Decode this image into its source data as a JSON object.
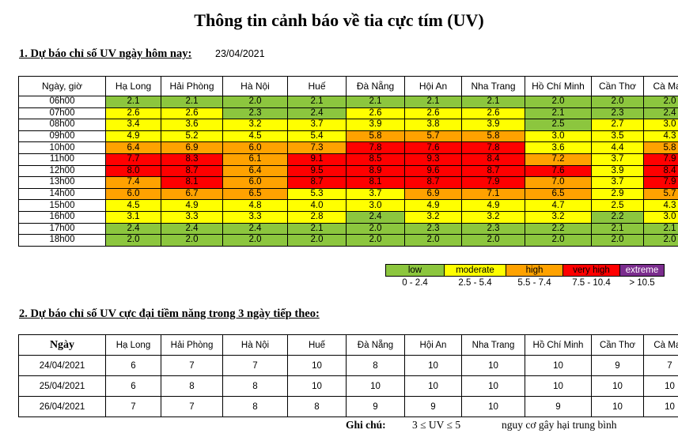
{
  "title": "Thông tin cảnh báo về tia cực tím (UV)",
  "section1": {
    "heading": "1. Dự báo chỉ số UV ngày hôm nay:",
    "date": "23/04/2021",
    "columns": [
      "Ngày, giờ",
      "Hạ Long",
      "Hải Phòng",
      "Hà Nội",
      "Huế",
      "Đà Nẵng",
      "Hội An",
      "Nha Trang",
      "Hồ Chí Minh",
      "Cần Thơ",
      "Cà Mau"
    ],
    "rows": [
      {
        "hour": "06h00",
        "values": [
          "2.1",
          "2.1",
          "2.0",
          "2.1",
          "2.1",
          "2.1",
          "2.1",
          "2.0",
          "2.0",
          "2.0"
        ],
        "levels": [
          "low",
          "low",
          "low",
          "low",
          "low",
          "low",
          "low",
          "low",
          "low",
          "low"
        ]
      },
      {
        "hour": "07h00",
        "values": [
          "2.6",
          "2.6",
          "2.3",
          "2.4",
          "2.6",
          "2.6",
          "2.6",
          "2.1",
          "2.3",
          "2.4"
        ],
        "levels": [
          "moderate",
          "moderate",
          "low",
          "low",
          "moderate",
          "moderate",
          "moderate",
          "low",
          "low",
          "low"
        ]
      },
      {
        "hour": "08h00",
        "values": [
          "3.4",
          "3.6",
          "3.2",
          "3.7",
          "3.9",
          "3.8",
          "3.9",
          "2.5",
          "2.7",
          "3.0"
        ],
        "levels": [
          "moderate",
          "moderate",
          "moderate",
          "moderate",
          "moderate",
          "moderate",
          "moderate",
          "low",
          "moderate",
          "moderate"
        ]
      },
      {
        "hour": "09h00",
        "values": [
          "4.9",
          "5.2",
          "4.5",
          "5.4",
          "5.8",
          "5.7",
          "5.8",
          "3.0",
          "3.5",
          "4.3"
        ],
        "levels": [
          "moderate",
          "moderate",
          "moderate",
          "moderate",
          "high",
          "high",
          "high",
          "moderate",
          "moderate",
          "moderate"
        ]
      },
      {
        "hour": "10h00",
        "values": [
          "6.4",
          "6.9",
          "6.0",
          "7.3",
          "7.8",
          "7.6",
          "7.8",
          "3.6",
          "4.4",
          "5.8"
        ],
        "levels": [
          "high",
          "high",
          "high",
          "high",
          "veryhigh",
          "veryhigh",
          "veryhigh",
          "moderate",
          "moderate",
          "high"
        ]
      },
      {
        "hour": "11h00",
        "values": [
          "7.7",
          "8.3",
          "6.1",
          "9.1",
          "8.5",
          "9.3",
          "8.4",
          "7.2",
          "3.7",
          "7.9"
        ],
        "levels": [
          "veryhigh",
          "veryhigh",
          "high",
          "veryhigh",
          "veryhigh",
          "veryhigh",
          "veryhigh",
          "high",
          "moderate",
          "veryhigh"
        ]
      },
      {
        "hour": "12h00",
        "values": [
          "8.0",
          "8.7",
          "6.4",
          "9.5",
          "8.9",
          "9.6",
          "8.7",
          "7.6",
          "3.9",
          "8.4"
        ],
        "levels": [
          "veryhigh",
          "veryhigh",
          "high",
          "veryhigh",
          "veryhigh",
          "veryhigh",
          "veryhigh",
          "veryhigh",
          "moderate",
          "veryhigh"
        ]
      },
      {
        "hour": "13h00",
        "values": [
          "7.4",
          "8.1",
          "6.0",
          "8.7",
          "8.1",
          "8.7",
          "7.9",
          "7.0",
          "3.7",
          "7.9"
        ],
        "levels": [
          "high",
          "veryhigh",
          "high",
          "veryhigh",
          "veryhigh",
          "veryhigh",
          "veryhigh",
          "high",
          "moderate",
          "veryhigh"
        ]
      },
      {
        "hour": "14h00",
        "values": [
          "6.0",
          "6.7",
          "6.5",
          "5.3",
          "3.7",
          "6.9",
          "7.1",
          "6.5",
          "2.9",
          "5.7"
        ],
        "levels": [
          "high",
          "high",
          "high",
          "moderate",
          "moderate",
          "high",
          "high",
          "high",
          "moderate",
          "high"
        ]
      },
      {
        "hour": "15h00",
        "values": [
          "4.5",
          "4.9",
          "4.8",
          "4.0",
          "3.0",
          "4.9",
          "4.9",
          "4.7",
          "2.5",
          "4.3"
        ],
        "levels": [
          "moderate",
          "moderate",
          "moderate",
          "moderate",
          "moderate",
          "moderate",
          "moderate",
          "moderate",
          "moderate",
          "moderate"
        ]
      },
      {
        "hour": "16h00",
        "values": [
          "3.1",
          "3.3",
          "3.3",
          "2.8",
          "2.4",
          "3.2",
          "3.2",
          "3.2",
          "2.2",
          "3.0"
        ],
        "levels": [
          "moderate",
          "moderate",
          "moderate",
          "moderate",
          "low",
          "moderate",
          "moderate",
          "moderate",
          "low",
          "moderate"
        ]
      },
      {
        "hour": "17h00",
        "values": [
          "2.4",
          "2.4",
          "2.4",
          "2.1",
          "2.0",
          "2.3",
          "2.3",
          "2.2",
          "2.1",
          "2.1"
        ],
        "levels": [
          "low",
          "low",
          "low",
          "low",
          "low",
          "low",
          "low",
          "low",
          "low",
          "low"
        ]
      },
      {
        "hour": "18h00",
        "values": [
          "2.0",
          "2.0",
          "2.0",
          "2.0",
          "2.0",
          "2.0",
          "2.0",
          "2.0",
          "2.0",
          "2.0"
        ],
        "levels": [
          "low",
          "low",
          "low",
          "low",
          "low",
          "low",
          "low",
          "low",
          "low",
          "low"
        ]
      }
    ]
  },
  "legend": {
    "labels": [
      "low",
      "moderate",
      "high",
      "very high",
      "extreme"
    ],
    "ranges": [
      "0 - 2.4",
      "2.5 - 5.4",
      "5.5 - 7.4",
      "7.5 - 10.4",
      "> 10.5"
    ],
    "colors": {
      "low": "#8CC63E",
      "moderate": "#FFFF00",
      "high": "#FFA200",
      "veryhigh": "#FF0000",
      "extreme": "#7B2D8E"
    }
  },
  "section2": {
    "heading": "2. Dự báo chỉ số UV cực đại tiềm năng trong 3 ngày tiếp theo:",
    "columns": [
      "Ngày",
      "Hạ Long",
      "Hải Phòng",
      "Hà Nội",
      "Huế",
      "Đà Nẵng",
      "Hội An",
      "Nha Trang",
      "Hồ Chí Minh",
      "Cần Thơ",
      "Cà Mau"
    ],
    "rows": [
      {
        "day": "24/04/2021",
        "values": [
          "6",
          "7",
          "7",
          "10",
          "8",
          "10",
          "10",
          "10",
          "9",
          "7"
        ]
      },
      {
        "day": "25/04/2021",
        "values": [
          "6",
          "8",
          "8",
          "10",
          "10",
          "10",
          "10",
          "10",
          "10",
          "10"
        ]
      },
      {
        "day": "26/04/2021",
        "values": [
          "7",
          "7",
          "8",
          "8",
          "9",
          "9",
          "10",
          "9",
          "10",
          "10"
        ]
      }
    ]
  },
  "footnote": {
    "label": "Ghi chú:",
    "formula": "3 ≤ UV ≤ 5",
    "description": "nguy cơ gây hại trung bình"
  }
}
